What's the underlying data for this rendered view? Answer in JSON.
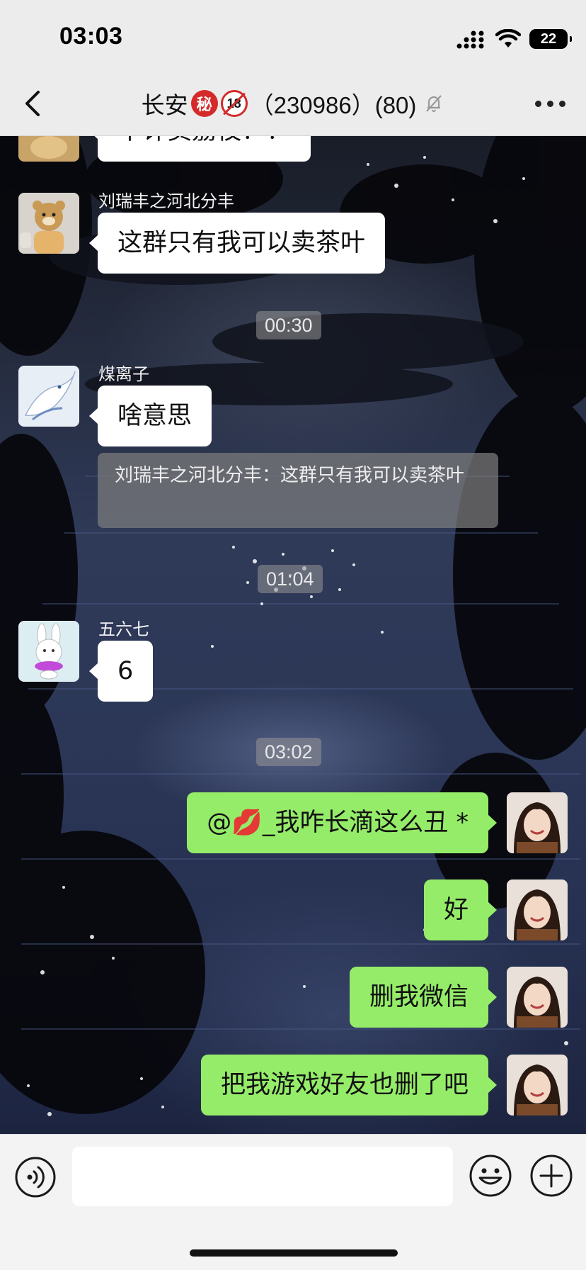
{
  "status_bar": {
    "time": "03:03",
    "battery": "22"
  },
  "header": {
    "group_name": "长安",
    "badge_secret": "秘",
    "badge_18": "18",
    "group_id": "（230986）(80)"
  },
  "messages": {
    "partial_top": "不许卖荔枝！！",
    "m1": {
      "sender": "刘瑞丰之河北分丰",
      "text": "这群只有我可以卖茶叶"
    },
    "t1": "00:30",
    "m2": {
      "sender": "煤离子",
      "text": "啥意思",
      "quote": "刘瑞丰之河北分丰：这群只有我可以卖茶叶"
    },
    "t2": "01:04",
    "m3": {
      "sender": "五六七",
      "text": "6"
    },
    "t3": "03:02",
    "out1": {
      "mention": "@",
      "emoji": "💋",
      "text": "_我咋长滴这么丑 *"
    },
    "out2": "好",
    "out3": "删我微信",
    "out4": "把我游戏好友也删了吧"
  },
  "input": {
    "placeholder": "",
    "value": ""
  },
  "colors": {
    "header_bg": "#ececec",
    "out_bubble": "#95ec69",
    "in_bubble": "#ffffff",
    "badge_red": "#d42a2a"
  },
  "icons": [
    "back-chevron-icon",
    "mute-bell-icon",
    "more-dots-icon",
    "voice-icon",
    "emoji-icon",
    "plus-icon"
  ]
}
